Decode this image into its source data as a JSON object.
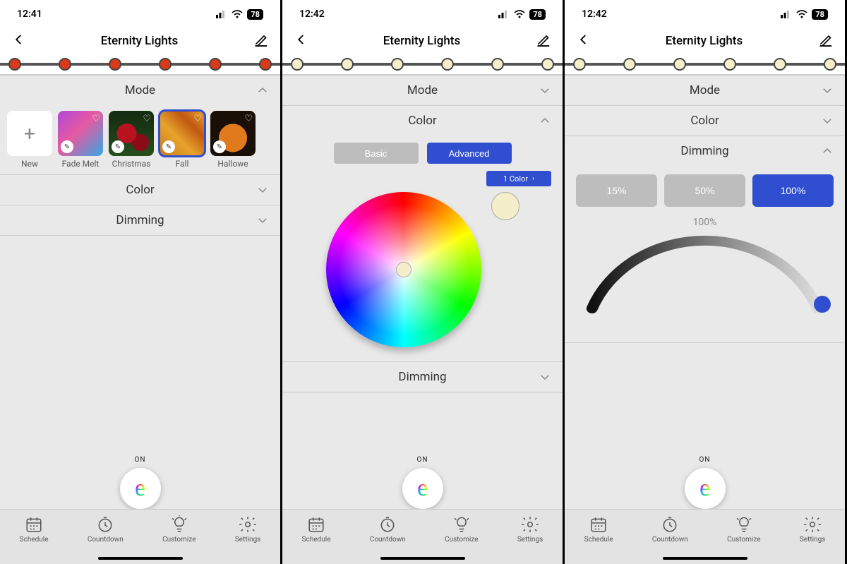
{
  "screens": [
    {
      "time": "12:41",
      "battery": "78",
      "title": "Eternity Lights",
      "led_color": "#d83a1a",
      "sections": {
        "mode": {
          "label": "Mode",
          "expanded": true
        },
        "color": {
          "label": "Color",
          "expanded": false
        },
        "dimming": {
          "label": "Dimming",
          "expanded": false
        }
      },
      "mode_items": [
        {
          "label": "New",
          "type": "new"
        },
        {
          "label": "Fade Melt",
          "type": "gradient"
        },
        {
          "label": "Christmas",
          "type": "christmas"
        },
        {
          "label": "Fall",
          "type": "fall",
          "selected": true
        },
        {
          "label": "Hallowe",
          "type": "halloween",
          "truncated": true
        }
      ],
      "power_state": "ON"
    },
    {
      "time": "12:42",
      "battery": "78",
      "title": "Eternity Lights",
      "led_color": "#f5eecb",
      "sections": {
        "mode": {
          "label": "Mode",
          "expanded": false
        },
        "color": {
          "label": "Color",
          "expanded": true
        },
        "dimming": {
          "label": "Dimming",
          "expanded": false
        }
      },
      "color_panel": {
        "basic_label": "Basic",
        "advanced_label": "Advanced",
        "selected_tab": "advanced",
        "count_pill": "1 Color",
        "swatch_color": "#f5eecb"
      },
      "power_state": "ON"
    },
    {
      "time": "12:42",
      "battery": "78",
      "title": "Eternity Lights",
      "led_color": "#f5eecb",
      "sections": {
        "mode": {
          "label": "Mode",
          "expanded": false
        },
        "color": {
          "label": "Color",
          "expanded": false
        },
        "dimming": {
          "label": "Dimming",
          "expanded": true
        }
      },
      "dimming_panel": {
        "presets": [
          "15%",
          "50%",
          "100%"
        ],
        "active_index": 2,
        "value_label": "100%"
      },
      "power_state": "ON"
    }
  ],
  "tabs": [
    {
      "label": "Schedule",
      "icon": "calendar-icon"
    },
    {
      "label": "Countdown",
      "icon": "clock-icon"
    },
    {
      "label": "Customize",
      "icon": "bulb-icon"
    },
    {
      "label": "Settings",
      "icon": "gear-icon"
    }
  ]
}
